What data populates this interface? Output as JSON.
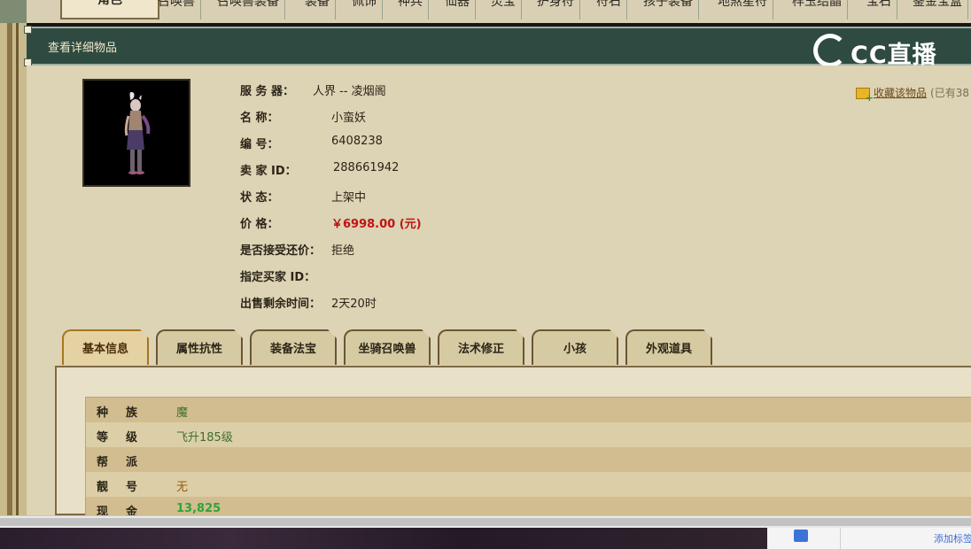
{
  "topnav": {
    "tabs": [
      {
        "label": "角色",
        "active": true
      },
      {
        "label": "召唤兽"
      },
      {
        "label": "召唤兽装备"
      },
      {
        "label": "装备"
      },
      {
        "label": "佩饰"
      },
      {
        "label": "神兵"
      },
      {
        "label": "仙器"
      },
      {
        "label": "灵宝"
      },
      {
        "label": "护身符"
      },
      {
        "label": "符石"
      },
      {
        "label": "孩子装备"
      },
      {
        "label": "地煞星符"
      },
      {
        "label": "样玉结晶"
      },
      {
        "label": "宝石"
      },
      {
        "label": "鉴金宝盒"
      }
    ]
  },
  "header": {
    "title": "查看详细物品"
  },
  "logo": {
    "text": "CC直播",
    "color": "#ffffff"
  },
  "item": {
    "rows": [
      {
        "label": "服 务 器：",
        "value": "人界 -- 凌烟阁"
      },
      {
        "label": "名          称：",
        "value": "小蛮妖"
      },
      {
        "label": "编          号：",
        "value": "6408238"
      },
      {
        "label": "卖    家   ID：",
        "value": "288661942"
      },
      {
        "label": "状          态：",
        "value": "上架中"
      },
      {
        "label": "价          格：",
        "value": "￥6998.00 (元)",
        "price": true
      },
      {
        "label": "是否接受还价：",
        "value": "拒绝"
      },
      {
        "label": "指定买家 ID：",
        "value": ""
      },
      {
        "label": "出售剩余时间：",
        "value": "2天20时"
      }
    ],
    "favorite": {
      "link": "收藏该物品",
      "count": "(已有38"
    }
  },
  "tabs": [
    {
      "label": "基本信息",
      "active": true
    },
    {
      "label": "属性抗性"
    },
    {
      "label": "装备法宝"
    },
    {
      "label": "坐骑召唤兽"
    },
    {
      "label": "法术修正"
    },
    {
      "label": "小孩"
    },
    {
      "label": "外观道具"
    }
  ],
  "attributes": [
    {
      "label": "种族",
      "value": "魔",
      "style": "green"
    },
    {
      "label": "等级",
      "value": "飞升185级",
      "style": "green"
    },
    {
      "label": "帮派",
      "value": ""
    },
    {
      "label": "靓号",
      "value": "无",
      "style": "brown"
    },
    {
      "label": "现金",
      "value": "13,825",
      "style": "bright"
    }
  ],
  "bookmark": {
    "text": "添加标签"
  },
  "colors": {
    "header_bg": "#2f4b41",
    "price": "#c11313",
    "page_bg": "#ddd3b5"
  }
}
